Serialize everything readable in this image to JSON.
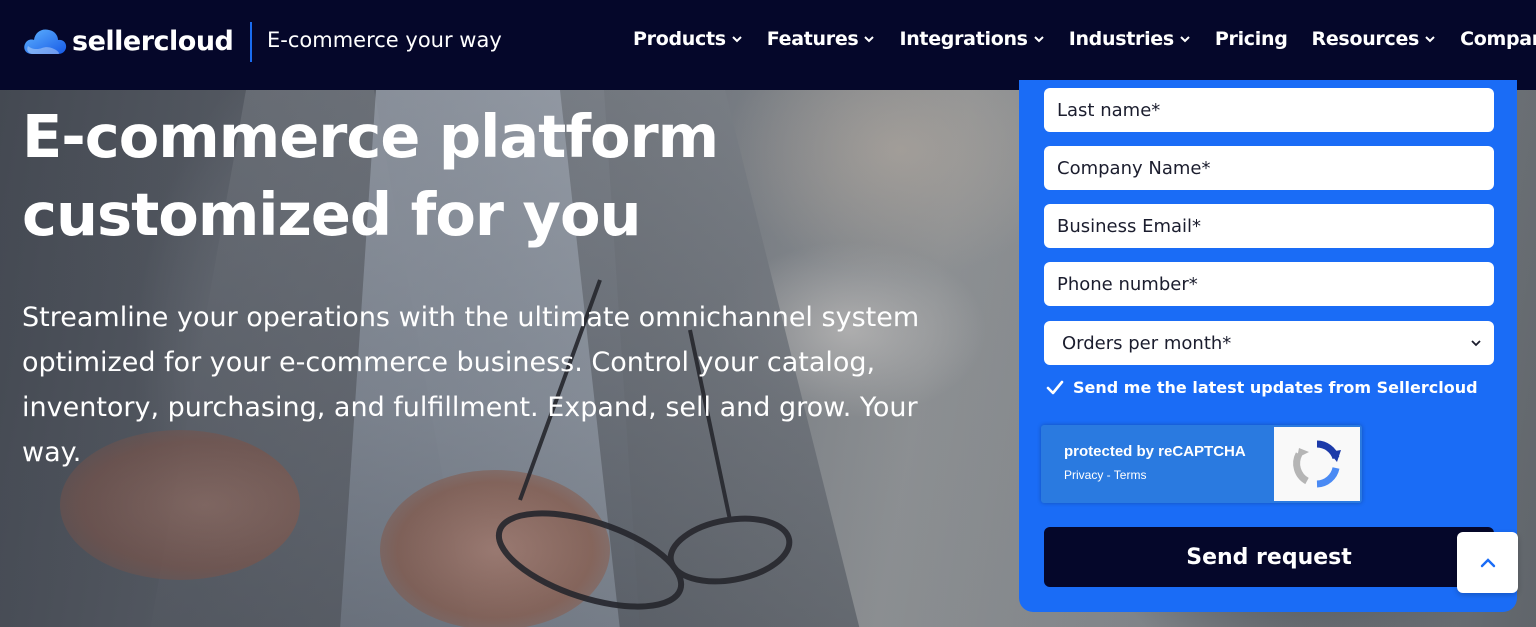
{
  "header": {
    "logo_text": "sellercloud",
    "tagline": "E-commerce your way",
    "nav": [
      {
        "label": "Products",
        "has_dropdown": true
      },
      {
        "label": "Features",
        "has_dropdown": true
      },
      {
        "label": "Integrations",
        "has_dropdown": true
      },
      {
        "label": "Industries",
        "has_dropdown": true
      },
      {
        "label": "Pricing",
        "has_dropdown": false
      },
      {
        "label": "Resources",
        "has_dropdown": true
      },
      {
        "label": "Company",
        "has_dropdown": true
      }
    ]
  },
  "hero": {
    "title_line1": "E-commerce platform",
    "title_line2": "customized for you",
    "subtitle": "Streamline your operations with the ultimate omnichannel system optimized for your e-commerce business. Control your catalog, inventory, purchasing, and fulfillment. Expand, sell and grow. Your way."
  },
  "form": {
    "last_name_placeholder": "Last name*",
    "company_placeholder": "Company Name*",
    "email_placeholder": "Business Email*",
    "phone_placeholder": "Phone number*",
    "orders_select_value": "Orders per month*",
    "consent_label": "Send me the latest updates from Sellercloud",
    "consent_checked": true,
    "recaptcha_title": "protected by reCAPTCHA",
    "recaptcha_links": "Privacy - Terms",
    "submit_label": "Send request"
  },
  "colors": {
    "header_bg": "#05072a",
    "form_bg": "#1a6cf6",
    "button_bg": "#05072a",
    "accent": "#1a6cf0"
  },
  "icons": {
    "logo": "cloud-logo-icon",
    "nav_dropdown": "chevron-down-icon",
    "select_dropdown": "chevron-down-icon",
    "consent": "checkmark-icon",
    "recaptcha": "recaptcha-logo-icon",
    "scroll_top": "chevron-up-icon"
  }
}
